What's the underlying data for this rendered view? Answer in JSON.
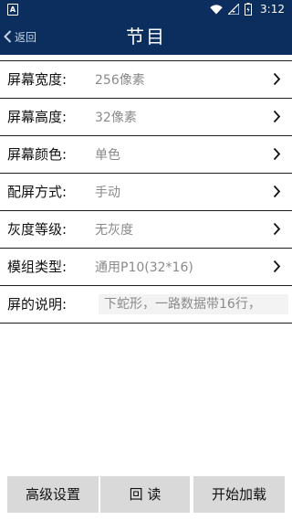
{
  "status_bar": {
    "notification_badge": "A",
    "time": "3:12",
    "icons": [
      "wifi-icon",
      "signal-icon",
      "battery-icon"
    ]
  },
  "header": {
    "back_label": "返回",
    "title": "节目",
    "background": "#0b2e5e"
  },
  "form": {
    "rows": [
      {
        "label": "屏幕宽度:",
        "value": "256像素"
      },
      {
        "label": "屏幕高度:",
        "value": "32像素"
      },
      {
        "label": "屏幕颜色:",
        "value": "单色"
      },
      {
        "label": "配屏方式:",
        "value": "手动"
      },
      {
        "label": "灰度等级:",
        "value": "无灰度"
      },
      {
        "label": "模组类型:",
        "value": "通用P10(32*16)"
      }
    ],
    "description": {
      "label": "屏的说明:",
      "value": "下蛇形，一路数据带16行，"
    }
  },
  "buttons": {
    "advanced": "高级设置",
    "read_back": "回 读",
    "start_load": "开始加载"
  }
}
